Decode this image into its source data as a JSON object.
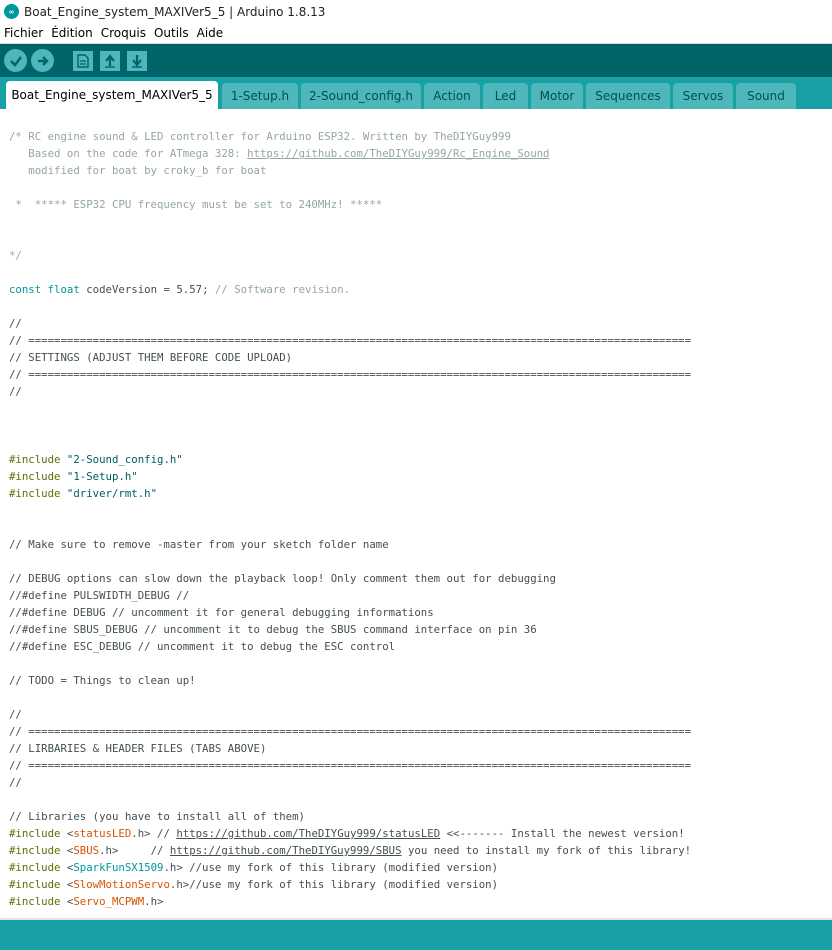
{
  "window": {
    "title": "Boat_Engine_system_MAXIVer5_5 | Arduino 1.8.13",
    "icon": "arduino-logo-icon"
  },
  "menu": [
    "Fichier",
    "Édition",
    "Croquis",
    "Outils",
    "Aide"
  ],
  "toolbar": {
    "buttons": [
      {
        "name": "verify",
        "icon": "check-icon"
      },
      {
        "name": "upload",
        "icon": "arrow-right-icon"
      },
      {
        "name": "new",
        "icon": "document-icon"
      },
      {
        "name": "open",
        "icon": "arrow-up-icon"
      },
      {
        "name": "save",
        "icon": "arrow-down-icon"
      }
    ]
  },
  "tabs": [
    {
      "label": "Boat_Engine_system_MAXIVer5_5",
      "active": true
    },
    {
      "label": "1-Setup.h"
    },
    {
      "label": "2-Sound_config.h"
    },
    {
      "label": "Action"
    },
    {
      "label": "Led"
    },
    {
      "label": "Motor"
    },
    {
      "label": "Sequences"
    },
    {
      "label": "Servos"
    },
    {
      "label": "Sound"
    }
  ],
  "colors": {
    "toolbar": "#006468",
    "tabbar": "#17a1a5",
    "tab": "#4db7bb",
    "keyword": "#00979c",
    "preprocessor": "#5e6d03",
    "string": "#005c5f",
    "literal": "#d35400",
    "comment": "#95a5a6"
  },
  "code": {
    "lines": [
      "/* RC engine sound & LED controller for Arduino ESP32. Written by TheDIYGuy999",
      "   Based on the code for ATmega 328: https://github.com/TheDIYGuy999/Rc_Engine_Sound",
      "   modified for boat by croky_b for boat",
      "",
      " *  ***** ESP32 CPU frequency must be set to 240MHz! *****",
      "",
      "",
      "*/",
      "",
      "const float codeVersion = 5.57; // Software revision.",
      "",
      "//",
      "// =======================================================================================================",
      "// SETTINGS (ADJUST THEM BEFORE CODE UPLOAD)",
      "// =======================================================================================================",
      "//",
      "",
      "",
      "",
      "#include \"2-Sound_config.h\"",
      "#include \"1-Setup.h\"",
      "#include \"driver/rmt.h\"",
      "",
      "",
      "// Make sure to remove -master from your sketch folder name",
      "",
      "// DEBUG options can slow down the playback loop! Only comment them out for debugging",
      "//#define PULSWIDTH_DEBUG //",
      "//#define DEBUG // uncomment it for general debugging informations",
      "//#define SBUS_DEBUG // uncomment it to debug the SBUS command interface on pin 36",
      "//#define ESC_DEBUG // uncomment it to debug the ESC control",
      "",
      "// TODO = Things to clean up!",
      "",
      "//",
      "// =======================================================================================================",
      "// LIRBARIES & HEADER FILES (TABS ABOVE)",
      "// =======================================================================================================",
      "//",
      "",
      "// Libraries (you have to install all of them)",
      "#include <statusLED.h> // https://github.com/TheDIYGuy999/statusLED <<------- Install the newest version!",
      "#include <SBUS.h>     // https://github.com/TheDIYGuy999/SBUS you need to install my fork of this library!",
      "#include <SparkFunSX1509.h> //use my fork of this library (modified version)",
      "#include <SlowMotionServo.h>//use my fork of this library (modified version)",
      "#include <Servo_MCPWM.h>"
    ]
  }
}
